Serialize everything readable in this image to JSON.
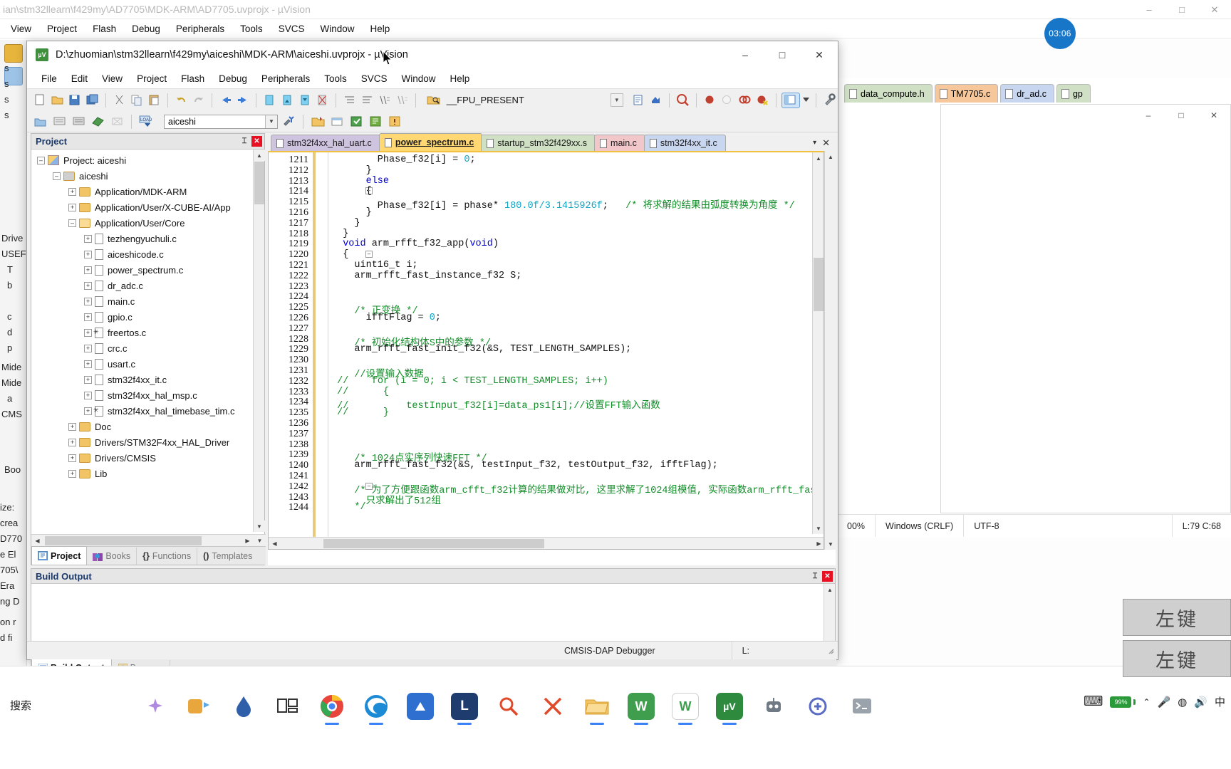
{
  "background_window": {
    "title": "ian\\stm32llearn\\f429my\\AD7705\\MDK-ARM\\AD7705.uvprojx - µVision",
    "menu": [
      "View",
      "Project",
      "Flash",
      "Debug",
      "Peripherals",
      "Tools",
      "SVCS",
      "Window",
      "Help"
    ],
    "caption_buttons": [
      "–",
      "□",
      "✕"
    ],
    "editor_tabs": [
      {
        "label": "data_compute.h",
        "color": "#cfe0c4"
      },
      {
        "label": "TM7705.c",
        "color": "#f6c79a"
      },
      {
        "label": "dr_ad.c",
        "color": "#c9d6ef"
      },
      {
        "label": "gp",
        "color": "#cfe0c4"
      }
    ],
    "inner_caption_buttons": [
      "–",
      "□",
      "✕"
    ],
    "status": [
      "00%",
      "Windows (CRLF)",
      "UTF-8"
    ],
    "status_right": "L:79 C:68",
    "debugger_label": "CMSIS-DAP Debugger",
    "left_fragments": [
      "s",
      "s",
      "s",
      "s",
      "Drive",
      "USEF",
      "T",
      "b",
      "c",
      "d",
      "p",
      "Mide",
      "Mide",
      "a",
      "CMS",
      "Boo",
      "ize:",
      "crea",
      "D770",
      "e El",
      "705\\",
      "Era",
      "ng D",
      "on r",
      "d fi"
    ]
  },
  "clock_badge": {
    "time": "03:06"
  },
  "foreground_window": {
    "title": "D:\\zhuomian\\stm32llearn\\f429my\\aiceshi\\MDK-ARM\\aiceshi.uvprojx - µVision",
    "app_icon_text": "µV",
    "caption_buttons": [
      "–",
      "□",
      "✕"
    ],
    "menu": [
      "File",
      "Edit",
      "View",
      "Project",
      "Flash",
      "Debug",
      "Peripherals",
      "Tools",
      "SVCS",
      "Window",
      "Help"
    ],
    "toolbar2": {
      "target_combo_value": "aiceshi",
      "fpu_text": "__FPU_PRESENT"
    },
    "project_pane": {
      "title": "Project",
      "pin_glyph": "⌶",
      "close_glyph": "✕",
      "tree": [
        {
          "depth": 0,
          "expander": "–",
          "icon": "project",
          "label": "Project: aiceshi"
        },
        {
          "depth": 1,
          "expander": "–",
          "icon": "target",
          "label": "aiceshi"
        },
        {
          "depth": 2,
          "expander": "+",
          "icon": "folder",
          "label": "Application/MDK-ARM"
        },
        {
          "depth": 2,
          "expander": "+",
          "icon": "folder",
          "label": "Application/User/X-CUBE-AI/App"
        },
        {
          "depth": 2,
          "expander": "–",
          "icon": "folderopen",
          "label": "Application/User/Core"
        },
        {
          "depth": 3,
          "expander": "+",
          "icon": "file",
          "label": "tezhengyuchuli.c"
        },
        {
          "depth": 3,
          "expander": "+",
          "icon": "file",
          "label": "aiceshicode.c"
        },
        {
          "depth": 3,
          "expander": "+",
          "icon": "file",
          "label": "power_spectrum.c"
        },
        {
          "depth": 3,
          "expander": "+",
          "icon": "file",
          "label": "dr_adc.c"
        },
        {
          "depth": 3,
          "expander": "+",
          "icon": "file",
          "label": "main.c"
        },
        {
          "depth": 3,
          "expander": "+",
          "icon": "file",
          "label": "gpio.c"
        },
        {
          "depth": 3,
          "expander": "+",
          "icon": "filestar",
          "label": "freertos.c"
        },
        {
          "depth": 3,
          "expander": "+",
          "icon": "file",
          "label": "crc.c"
        },
        {
          "depth": 3,
          "expander": "+",
          "icon": "file",
          "label": "usart.c"
        },
        {
          "depth": 3,
          "expander": "+",
          "icon": "file",
          "label": "stm32f4xx_it.c"
        },
        {
          "depth": 3,
          "expander": "+",
          "icon": "file",
          "label": "stm32f4xx_hal_msp.c"
        },
        {
          "depth": 3,
          "expander": "+",
          "icon": "filestar",
          "label": "stm32f4xx_hal_timebase_tim.c"
        },
        {
          "depth": 2,
          "expander": "+",
          "icon": "folder",
          "label": "Doc"
        },
        {
          "depth": 2,
          "expander": "+",
          "icon": "folder",
          "label": "Drivers/STM32F4xx_HAL_Driver"
        },
        {
          "depth": 2,
          "expander": "+",
          "icon": "folder",
          "label": "Drivers/CMSIS"
        },
        {
          "depth": 2,
          "expander": "+",
          "icon": "folder",
          "label": "Lib"
        }
      ],
      "bottom_tabs": [
        {
          "label": "Project",
          "active": true,
          "icon": "project-icon"
        },
        {
          "label": "Books",
          "active": false,
          "icon": "books-icon"
        },
        {
          "label": "Functions",
          "active": false,
          "icon": "{}"
        },
        {
          "label": "Templates",
          "active": false,
          "icon": "()"
        }
      ]
    },
    "editor": {
      "tabs": [
        {
          "label": "stm32f4xx_hal_uart.c",
          "state": "purple"
        },
        {
          "label": "power_spectrum.c",
          "state": "active"
        },
        {
          "label": "startup_stm32f429xx.s",
          "state": "green"
        },
        {
          "label": "main.c",
          "state": "pink"
        },
        {
          "label": "stm32f4xx_it.c",
          "state": "blue"
        }
      ],
      "tab_buttons": [
        "▾",
        "✕"
      ],
      "first_line_number": 1211,
      "lines": [
        {
          "n": 1211,
          "indent": 8,
          "text": "Phase_f32[i] = ",
          "tail_num": "0",
          "tail": ";"
        },
        {
          "n": 1212,
          "indent": 6,
          "text": "}"
        },
        {
          "n": 1213,
          "indent": 6,
          "kw": "else"
        },
        {
          "n": 1214,
          "indent": 6,
          "text": "{",
          "fold": "–"
        },
        {
          "n": 1215,
          "indent": 8,
          "text": "Phase_f32[i] = phase* ",
          "tail_num": "180.0f/3.1415926f",
          "tail": ";",
          "comment": "/* 将求解的结果由弧度转换为角度 */"
        },
        {
          "n": 1216,
          "indent": 6,
          "text": "}"
        },
        {
          "n": 1217,
          "indent": 4,
          "text": "}"
        },
        {
          "n": 1218,
          "indent": 2,
          "text": "}"
        },
        {
          "n": 1219,
          "indent": 2,
          "kw": "void",
          "text": " arm_rfft_f32_app(",
          "kw2": "void",
          "tail": ")"
        },
        {
          "n": 1220,
          "indent": 2,
          "text": "{",
          "fold": "–"
        },
        {
          "n": 1221,
          "indent": 4,
          "text": "uint16_t i;"
        },
        {
          "n": 1222,
          "indent": 4,
          "text": "arm_rfft_fast_instance_f32 S;"
        },
        {
          "n": 1223,
          "indent": 0,
          "text": ""
        },
        {
          "n": 1224,
          "indent": 0,
          "text": ""
        },
        {
          "n": 1225,
          "indent": 4,
          "comment": "/* 正变换 */"
        },
        {
          "n": 1226,
          "indent": 6,
          "text": "ifftFlag = ",
          "tail_num": "0",
          "tail": ";"
        },
        {
          "n": 1227,
          "indent": 0,
          "text": ""
        },
        {
          "n": 1228,
          "indent": 4,
          "comment": "/* 初始化结构体S中的参数 */"
        },
        {
          "n": 1229,
          "indent": 4,
          "text": "arm_rfft_fast_init_f32(&S, TEST_LENGTH_SAMPLES);"
        },
        {
          "n": 1230,
          "indent": 0,
          "text": ""
        },
        {
          "n": 1231,
          "indent": 4,
          "comment": "//设置输入数据"
        },
        {
          "n": 1232,
          "indent": 1,
          "comment": "//    for (i = 0; i < TEST_LENGTH_SAMPLES; i++)"
        },
        {
          "n": 1233,
          "indent": 1,
          "comment": "//      {"
        },
        {
          "n": 1234,
          "indent": 1,
          "comment": "//          testInput_f32[i]=data_ps1[i];//设置FFT输入函数"
        },
        {
          "n": 1235,
          "indent": 1,
          "comment": "//      }"
        },
        {
          "n": 1236,
          "indent": 0,
          "text": ""
        },
        {
          "n": 1237,
          "indent": 0,
          "text": ""
        },
        {
          "n": 1238,
          "indent": 0,
          "text": ""
        },
        {
          "n": 1239,
          "indent": 4,
          "comment": "/* 1024点实序列快速FFT */"
        },
        {
          "n": 1240,
          "indent": 4,
          "text": "arm_rfft_fast_f32(&S, testInput_f32, testOutput_f32, ifftFlag);"
        },
        {
          "n": 1241,
          "indent": 0,
          "text": ""
        },
        {
          "n": 1242,
          "indent": 4,
          "comment": "/* 为了方便跟函数arm_cfft_f32计算的结果做对比, 这里求解了1024组模值, 实际函数arm_rfft_fas",
          "fold": "–"
        },
        {
          "n": 1243,
          "indent": 6,
          "comment": "只求解出了512组"
        },
        {
          "n": 1244,
          "indent": 4,
          "comment": "*/"
        }
      ]
    },
    "build_output": {
      "title": "Build Output",
      "pin_glyph": "⌶",
      "close_glyph": "✕",
      "content": "",
      "tabs": [
        {
          "label": "Build Output",
          "active": true
        },
        {
          "label": "Browser",
          "active": false
        }
      ]
    },
    "statusbar": {
      "debugger": "CMSIS-DAP Debugger",
      "cursor": "L:"
    }
  },
  "taskbar": {
    "search_label": "搜索",
    "items": [
      {
        "name": "task-view-icon",
        "glyph": "❏",
        "color": "#3a3a3a",
        "bg": "transparent"
      },
      {
        "name": "chrome-icon",
        "glyph": "",
        "color": "#fff",
        "bg": "#e8453c"
      },
      {
        "name": "edge-icon",
        "glyph": "",
        "color": "#fff",
        "bg": "#1d8ad6"
      },
      {
        "name": "app-blue-icon",
        "glyph": "",
        "color": "#fff",
        "bg": "#2f6fd0"
      },
      {
        "name": "line-icon",
        "glyph": "L",
        "color": "#fff",
        "bg": "#1f3c6e"
      },
      {
        "name": "search-red-icon",
        "glyph": "",
        "color": "#e04a2a",
        "bg": "transparent"
      },
      {
        "name": "close-x-icon",
        "glyph": "✕",
        "color": "#e04a2a",
        "bg": "transparent"
      },
      {
        "name": "explorer-icon",
        "glyph": "",
        "color": "#e8a83c",
        "bg": "transparent"
      },
      {
        "name": "wps-green-icon",
        "glyph": "W",
        "color": "#fff",
        "bg": "#3f9e4d"
      },
      {
        "name": "wps-white-icon",
        "glyph": "W",
        "color": "#3f9e4d",
        "bg": "#ffffff"
      },
      {
        "name": "keil-uvision-icon",
        "glyph": "µV",
        "color": "#fff",
        "bg": "#2e8b3e"
      },
      {
        "name": "robot-icon",
        "glyph": "",
        "color": "#4a4a4a",
        "bg": "transparent"
      },
      {
        "name": "ai-tool-icon",
        "glyph": "",
        "color": "#5b6cc4",
        "bg": "transparent"
      },
      {
        "name": "terminal-icon",
        "glyph": "",
        "color": "#7a7a7a",
        "bg": "transparent"
      }
    ],
    "tray": {
      "keyboard_glyph": "⌨",
      "battery_percent": "99%",
      "chevron_glyph": "⌃",
      "mic_glyph": "🎤",
      "wifi_glyph": "◍",
      "volume_glyph": "🔊",
      "ime_label": "中"
    }
  },
  "overlay_keycaps": [
    {
      "label": "左键"
    },
    {
      "label": "左键"
    }
  ]
}
